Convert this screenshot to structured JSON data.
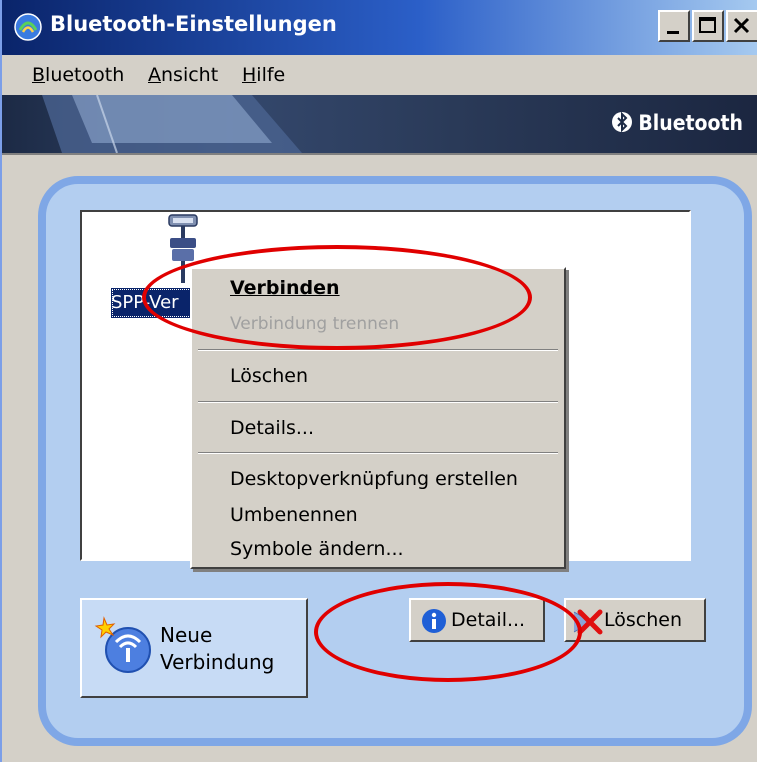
{
  "window": {
    "title": "Bluetooth-Einstellungen",
    "caption_buttons": [
      "minimize",
      "maximize",
      "close"
    ]
  },
  "menubar": {
    "items": [
      {
        "label": "Bluetooth",
        "mnemonic": "B"
      },
      {
        "label": "Ansicht",
        "mnemonic": "A"
      },
      {
        "label": "Hilfe",
        "mnemonic": "H"
      }
    ]
  },
  "banner": {
    "brand": "Bluetooth"
  },
  "device": {
    "label": "SPP-Ver",
    "icon": "serial-port-icon"
  },
  "context_menu": {
    "items": [
      {
        "label": "Verbinden",
        "default": true,
        "enabled": true
      },
      {
        "label": "Verbindung trennen",
        "enabled": false
      },
      {
        "label": "Löschen",
        "enabled": true
      },
      {
        "label": "Details...",
        "enabled": true
      },
      {
        "label": "Desktopverknüpfung erstellen",
        "enabled": true
      },
      {
        "label": "Umbenennen",
        "enabled": true
      },
      {
        "label": "Symbole ändern...",
        "enabled": true
      }
    ]
  },
  "buttons": {
    "new_connection_line1": "Neue",
    "new_connection_line2": "Verbindung",
    "detail": "Detail...",
    "delete": "Löschen"
  },
  "colors": {
    "title_bar": "#0a246a",
    "panel_fill": "#b3cef0",
    "panel_border": "#7fa7e6",
    "highlight_ellipse": "#e00000",
    "selection": "#0a246a"
  }
}
